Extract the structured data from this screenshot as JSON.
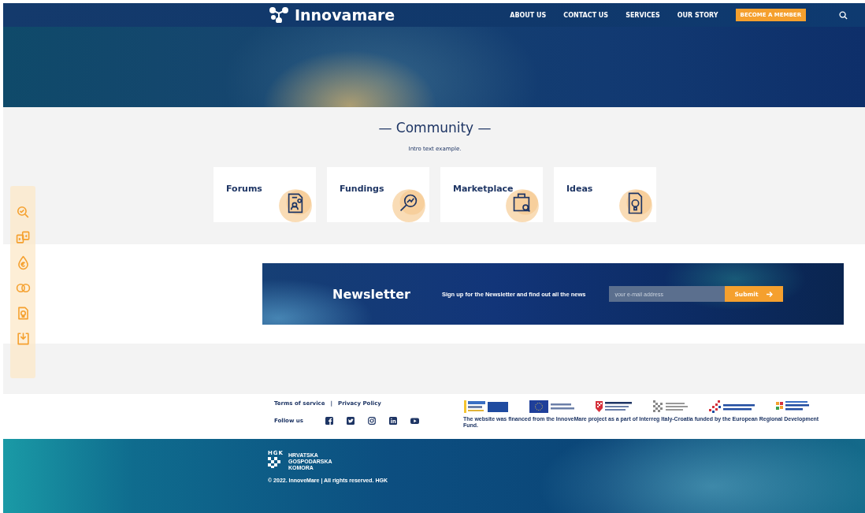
{
  "header": {
    "logo": "Innovamare",
    "nav": [
      {
        "label": "ABOUT US"
      },
      {
        "label": "CONTACT US"
      },
      {
        "label": "SERVICES"
      },
      {
        "label": "OUR STORY"
      }
    ],
    "cta": "BECOME A MEMBER"
  },
  "sidebar": {
    "items": [
      {
        "kind": "search-check"
      },
      {
        "kind": "swap"
      },
      {
        "kind": "euro"
      },
      {
        "kind": "rings"
      },
      {
        "kind": "idea"
      },
      {
        "kind": "download"
      }
    ]
  },
  "community": {
    "title": "— Community —",
    "intro": "Intro text example.",
    "cards": [
      {
        "label": "Forums",
        "kind": "forum"
      },
      {
        "label": "Fundings",
        "kind": "funding"
      },
      {
        "label": "Marketplace",
        "kind": "market"
      },
      {
        "label": "Ideas",
        "kind": "idea"
      }
    ]
  },
  "newsletter": {
    "title": "Newsletter",
    "text": "Sign up for the Newsletter and find out all the news",
    "placeholder": "your e-mail address",
    "button": "Submit"
  },
  "footer": {
    "links": [
      "Terms of service",
      "Privacy Policy"
    ],
    "separator": "|",
    "follow": "Follow us",
    "socials": [
      {
        "kind": "facebook"
      },
      {
        "kind": "twitter"
      },
      {
        "kind": "instagram"
      },
      {
        "kind": "linkedin"
      },
      {
        "kind": "youtube"
      }
    ],
    "logos": [
      {
        "kind": "interreg"
      },
      {
        "kind": "eu"
      },
      {
        "kind": "croatia"
      },
      {
        "kind": "hgk"
      },
      {
        "kind": "esi"
      },
      {
        "kind": "op"
      }
    ],
    "notice": "The website was financed from the InnoveMare project as a part of Interreg Italy-Croatia funded by the European Regional Development Fund."
  },
  "bottom": {
    "mark": "HGK",
    "name": "HRVATSKA GOSPODARSKA KOMORA",
    "copyright": "© 2022. InnoveMare | All rights reserved. HGK"
  }
}
